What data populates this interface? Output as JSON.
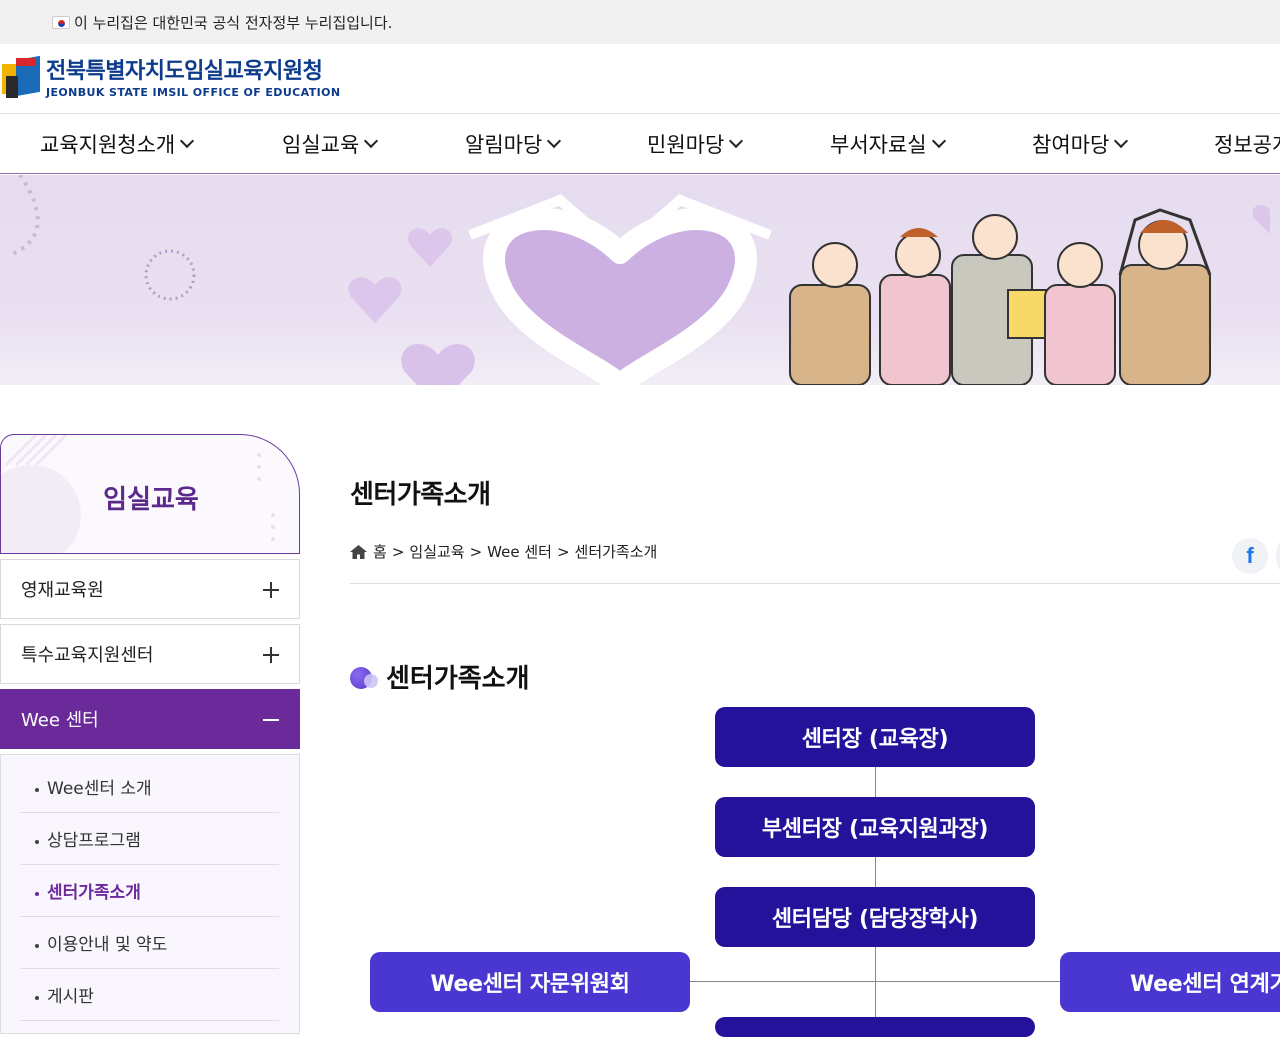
{
  "gov_banner": {
    "text": "이 누리집은 대한민국 공식 전자정부 누리집입니다."
  },
  "logo": {
    "name_ko": "전북특별자치도임실교육지원청",
    "name_en": "JEONBUK STATE IMSIL OFFICE OF EDUCATION"
  },
  "gnb": [
    {
      "label": "교육지원청소개"
    },
    {
      "label": "임실교육"
    },
    {
      "label": "알림마당"
    },
    {
      "label": "민원마당"
    },
    {
      "label": "부서자료실"
    },
    {
      "label": "참여마당"
    },
    {
      "label": "정보공개"
    }
  ],
  "sidebar": {
    "title": "임실교육",
    "menu": [
      {
        "label": "영재교육원",
        "expanded": false
      },
      {
        "label": "특수교육지원센터",
        "expanded": false
      },
      {
        "label": "Wee 센터",
        "expanded": true
      }
    ],
    "submenu": [
      {
        "label": "Wee센터 소개"
      },
      {
        "label": "상담프로그램"
      },
      {
        "label": "센터가족소개",
        "active": true
      },
      {
        "label": "이용안내 및 약도"
      },
      {
        "label": "게시판"
      }
    ]
  },
  "content": {
    "page_title": "센터가족소개",
    "breadcrumb": [
      "홈",
      "임실교육",
      "Wee 센터",
      "센터가족소개"
    ],
    "breadcrumb_sep": ">",
    "section_title": "센터가족소개",
    "share": {
      "facebook": "f"
    },
    "org_chart": {
      "head": "센터장 (교육장)",
      "vice": "부센터장 (교육지원과장)",
      "manager": "센터담당 (담당장학사)",
      "left": "Wee센터 자문위원회",
      "right": "Wee센터 연계기관"
    }
  },
  "colors": {
    "primary_purple": "#6a2a9a",
    "org_dark": "#24129a",
    "org_light": "#4a36d0",
    "logo_blue": "#0d3b8c"
  }
}
